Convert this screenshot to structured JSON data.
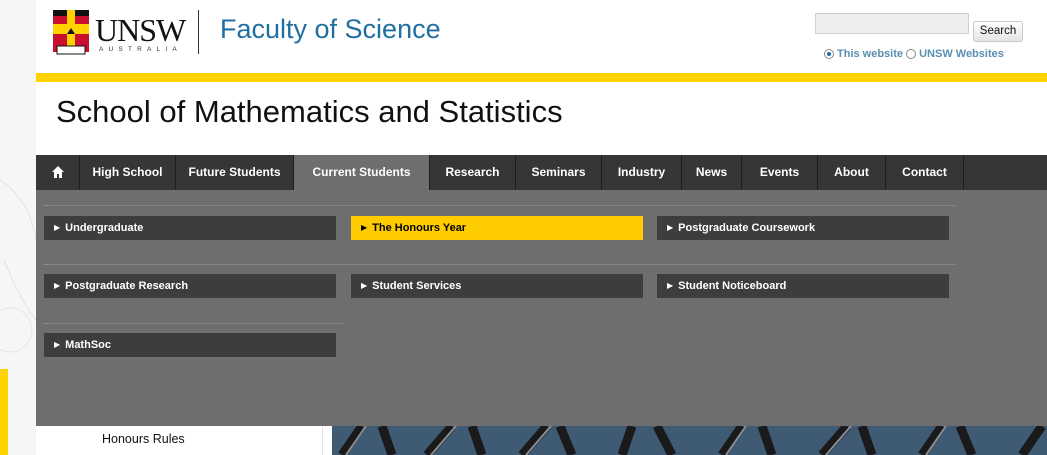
{
  "header": {
    "logo_word": "UNSW",
    "logo_sub": "AUSTRALIA",
    "faculty_title": "Faculty of Science",
    "search": {
      "value": "",
      "placeholder": "",
      "button_label": "Search"
    },
    "scope_options": [
      {
        "label": "This website",
        "selected": true
      },
      {
        "label": "UNSW Websites",
        "selected": false
      }
    ]
  },
  "school_title": "School of Mathematics and Statistics",
  "nav": {
    "home_icon": "home-icon",
    "items": [
      {
        "label": "High School"
      },
      {
        "label": "Future Students"
      },
      {
        "label": "Current Students",
        "active": true
      },
      {
        "label": "Research"
      },
      {
        "label": "Seminars"
      },
      {
        "label": "Industry"
      },
      {
        "label": "News"
      },
      {
        "label": "Events"
      },
      {
        "label": "About"
      },
      {
        "label": "Contact"
      }
    ]
  },
  "submenu": {
    "items": [
      {
        "label": "Undergraduate"
      },
      {
        "label": "The Honours Year",
        "active": true
      },
      {
        "label": "Postgraduate Coursework"
      },
      {
        "label": "Postgraduate Research"
      },
      {
        "label": "Student Services"
      },
      {
        "label": "Student Noticeboard"
      },
      {
        "label": "MathSoc"
      }
    ]
  },
  "sidebar": {
    "link": "Honours Rules"
  },
  "colors": {
    "accent_yellow": "#ffd200",
    "brand_blue": "#1f6fa3",
    "nav_dark": "#363636",
    "nav_active": "#6e6e6e",
    "submenu_active": "#ffcc00"
  }
}
